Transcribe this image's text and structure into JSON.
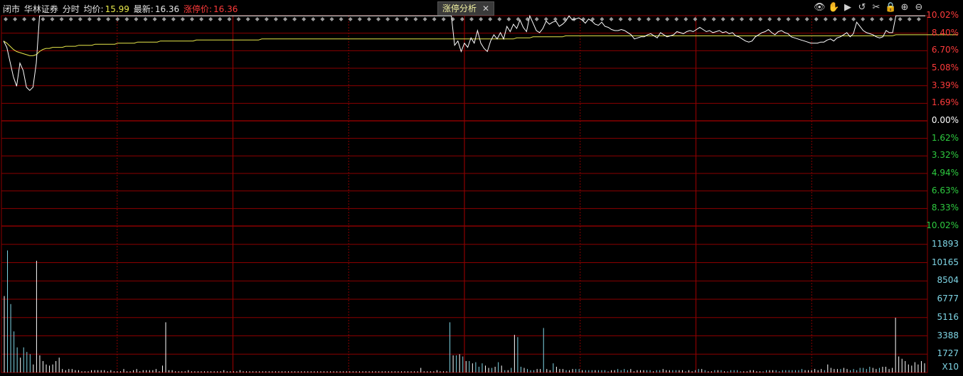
{
  "header": {
    "status": "闭市",
    "stock_name": "华林证券",
    "view_mode": "分时",
    "avg_label": "均价:",
    "avg_value": "15.99",
    "latest_label": "最新:",
    "latest_value": "16.36",
    "limit_label": "涨停价:",
    "limit_value": "16.36"
  },
  "analysis_tab": {
    "label": "涨停分析",
    "close": "✕"
  },
  "toolbar": {
    "items": [
      {
        "name": "eye-icon",
        "glyph": "👁"
      },
      {
        "name": "hand-icon",
        "glyph": "✋"
      },
      {
        "name": "play-icon",
        "glyph": "▶"
      },
      {
        "name": "undo-icon",
        "glyph": "↺"
      },
      {
        "name": "scissors-icon",
        "glyph": "✂"
      },
      {
        "name": "lock-icon",
        "glyph": "🔒"
      },
      {
        "name": "zoom-in-icon",
        "glyph": "⊕"
      },
      {
        "name": "zoom-out-icon",
        "glyph": "⊖"
      }
    ]
  },
  "colors": {
    "grid": "#8b0000",
    "price_line": "#ffffff",
    "avg_line": "#e8e84a",
    "up": "#ff3b3b",
    "down": "#2ecc40",
    "vol": "#7fd6e6",
    "vol_up": "#ffffff"
  },
  "chart_data": {
    "type": "line",
    "price_axis_labels": [
      {
        "text": "10.02%",
        "color": "up"
      },
      {
        "text": "8.40%",
        "color": "up"
      },
      {
        "text": "6.70%",
        "color": "up"
      },
      {
        "text": "5.08%",
        "color": "up"
      },
      {
        "text": "3.39%",
        "color": "up"
      },
      {
        "text": "1.69%",
        "color": "up"
      },
      {
        "text": "0.00%",
        "color": "white"
      },
      {
        "text": "1.62%",
        "color": "down"
      },
      {
        "text": "3.32%",
        "color": "down"
      },
      {
        "text": "4.94%",
        "color": "down"
      },
      {
        "text": "6.63%",
        "color": "down"
      },
      {
        "text": "8.33%",
        "color": "down"
      },
      {
        "text": "10.02%",
        "color": "down"
      }
    ],
    "volume_axis_labels": [
      "11893",
      "10165",
      "8504",
      "6777",
      "5116",
      "3388",
      "1727",
      "X10"
    ],
    "ylim_pct": [
      -10.02,
      10.02
    ],
    "price_pct": [
      7.6,
      7.0,
      5.6,
      4.2,
      3.3,
      5.5,
      4.8,
      3.2,
      2.9,
      3.2,
      5.5,
      10.0,
      10.0,
      10.0,
      10.0,
      10.0,
      10.0,
      10.0,
      10.0,
      10.0,
      10.0,
      10.0,
      10.0,
      10.0,
      10.0,
      10.0,
      10.0,
      10.0,
      10.0,
      10.0,
      10.0,
      10.0,
      10.0,
      10.0,
      10.0,
      10.0,
      10.0,
      10.0,
      10.0,
      10.0,
      10.0,
      10.0,
      10.0,
      10.0,
      10.0,
      10.0,
      10.0,
      10.0,
      10.0,
      10.0,
      10.0,
      10.0,
      10.0,
      10.0,
      10.0,
      10.0,
      10.0,
      10.0,
      10.0,
      10.0,
      10.0,
      10.0,
      10.0,
      10.0,
      10.0,
      10.0,
      10.0,
      10.0,
      10.0,
      10.0,
      10.0,
      10.0,
      10.0,
      10.0,
      10.0,
      10.0,
      10.0,
      10.0,
      10.0,
      10.0,
      10.0,
      10.0,
      10.0,
      10.0,
      10.0,
      10.0,
      10.0,
      10.0,
      10.0,
      10.0,
      10.0,
      10.0,
      10.0,
      10.0,
      10.0,
      10.0,
      10.0,
      10.0,
      10.0,
      10.0,
      10.0,
      10.0,
      10.0,
      10.0,
      10.0,
      10.0,
      10.0,
      10.0,
      10.0,
      10.0,
      10.0,
      10.0,
      10.0,
      10.0,
      10.0,
      10.0,
      10.0,
      10.0,
      10.0,
      10.0,
      10.0,
      10.0,
      10.0,
      10.0,
      10.0,
      10.0,
      10.0,
      10.0,
      10.0,
      10.0,
      10.0,
      10.0,
      10.0,
      10.0,
      10.0,
      10.0,
      10.0,
      10.0,
      7.2,
      7.6,
      6.6,
      7.4,
      7.0,
      7.9,
      7.4,
      8.6,
      7.4,
      6.9,
      6.6,
      7.6,
      8.2,
      7.8,
      8.4,
      7.8,
      9.0,
      8.5,
      9.2,
      8.8,
      9.6,
      8.9,
      8.5,
      10.0,
      9.3,
      8.6,
      8.4,
      8.8,
      9.5,
      9.2,
      9.4,
      9.5,
      9.0,
      9.2,
      9.5,
      10.0,
      9.6,
      9.7,
      9.8,
      9.6,
      9.3,
      9.7,
      9.5,
      9.2,
      9.1,
      9.4,
      9.0,
      8.9,
      8.7,
      8.6,
      8.6,
      8.7,
      8.6,
      8.4,
      8.2,
      7.8,
      7.9,
      8.0,
      8.0,
      8.2,
      8.3,
      8.1,
      7.9,
      8.4,
      8.2,
      8.0,
      8.1,
      8.2,
      8.5,
      8.4,
      8.3,
      8.5,
      8.6,
      8.5,
      8.7,
      8.9,
      8.7,
      8.5,
      8.6,
      8.4,
      8.5,
      8.6,
      8.4,
      8.5,
      8.3,
      8.4,
      8.1,
      8.0,
      7.8,
      7.6,
      7.5,
      7.6,
      8.0,
      8.2,
      8.4,
      8.5,
      8.7,
      8.4,
      8.2,
      8.5,
      8.6,
      8.4,
      8.3,
      8.0,
      7.9,
      7.8,
      7.7,
      7.6,
      7.5,
      7.4,
      7.4,
      7.4,
      7.5,
      7.5,
      7.7,
      7.8,
      7.6,
      7.9,
      8.0,
      8.2,
      8.4,
      8.0,
      8.3,
      9.4,
      9.0,
      8.6,
      8.4,
      8.3,
      8.2,
      8.0,
      7.9,
      8.0,
      8.6,
      8.4,
      8.4,
      10.0,
      10.0,
      10.0,
      10.0,
      10.0,
      10.0,
      10.0,
      10.0,
      10.0,
      10.0
    ],
    "avg_pct": [
      7.6,
      7.4,
      7.1,
      6.8,
      6.6,
      6.5,
      6.4,
      6.3,
      6.2,
      6.2,
      6.3,
      6.6,
      6.8,
      6.9,
      6.9,
      7.0,
      7.0,
      7.0,
      7.0,
      7.1,
      7.1,
      7.1,
      7.1,
      7.2,
      7.2,
      7.2,
      7.2,
      7.2,
      7.3,
      7.3,
      7.3,
      7.3,
      7.3,
      7.3,
      7.3,
      7.4,
      7.4,
      7.4,
      7.4,
      7.4,
      7.4,
      7.5,
      7.5,
      7.5,
      7.5,
      7.5,
      7.5,
      7.5,
      7.6,
      7.6,
      7.6,
      7.6,
      7.6,
      7.6,
      7.6,
      7.6,
      7.6,
      7.6,
      7.6,
      7.7,
      7.7,
      7.7,
      7.7,
      7.7,
      7.7,
      7.7,
      7.7,
      7.7,
      7.7,
      7.7,
      7.7,
      7.7,
      7.7,
      7.7,
      7.7,
      7.7,
      7.7,
      7.7,
      7.7,
      7.8,
      7.8,
      7.8,
      7.8,
      7.8,
      7.8,
      7.8,
      7.8,
      7.8,
      7.8,
      7.8,
      7.8,
      7.8,
      7.8,
      7.8,
      7.8,
      7.8,
      7.8,
      7.8,
      7.8,
      7.8,
      7.8,
      7.8,
      7.8,
      7.8,
      7.8,
      7.8,
      7.8,
      7.8,
      7.8,
      7.8,
      7.8,
      7.8,
      7.8,
      7.8,
      7.8,
      7.8,
      7.8,
      7.8,
      7.8,
      7.8,
      7.8,
      7.8,
      7.8,
      7.8,
      7.8,
      7.8,
      7.8,
      7.8,
      7.8,
      7.8,
      7.8,
      7.8,
      7.8,
      7.8,
      7.8,
      7.8,
      7.8,
      7.8,
      7.8,
      7.8,
      7.8,
      7.8,
      7.8,
      7.8,
      7.8,
      7.8,
      7.8,
      7.8,
      7.8,
      7.8,
      7.8,
      7.8,
      7.8,
      7.8,
      7.8,
      7.8,
      7.8,
      7.9,
      7.9,
      7.9,
      7.9,
      7.9,
      8.0,
      8.0,
      8.0,
      8.0,
      8.0,
      8.0,
      8.0,
      8.0,
      8.0,
      8.0,
      8.1,
      8.1,
      8.1,
      8.1,
      8.1,
      8.1,
      8.1,
      8.1,
      8.1,
      8.1,
      8.1,
      8.1,
      8.1,
      8.1,
      8.1,
      8.1,
      8.1,
      8.1,
      8.1,
      8.1,
      8.1,
      8.1,
      8.1,
      8.1,
      8.1,
      8.1,
      8.1,
      8.1,
      8.1,
      8.1,
      8.1,
      8.1,
      8.1,
      8.1,
      8.1,
      8.1,
      8.1,
      8.1,
      8.1,
      8.1,
      8.1,
      8.1,
      8.1,
      8.1,
      8.1,
      8.1,
      8.1,
      8.1,
      8.1,
      8.1,
      8.1,
      8.1,
      8.1,
      8.1,
      8.1,
      8.1,
      8.1,
      8.1,
      8.1,
      8.1,
      8.1,
      8.1,
      8.1,
      8.1,
      8.1,
      8.1,
      8.1,
      8.1,
      8.1,
      8.1,
      8.1,
      8.1,
      8.1,
      8.1,
      8.1,
      8.1,
      8.1,
      8.1,
      8.1,
      8.1,
      8.1,
      8.1,
      8.1,
      8.1,
      8.1,
      8.1,
      8.1,
      8.1,
      8.1,
      8.1,
      8.1,
      8.1,
      8.1,
      8.1,
      8.1,
      8.1,
      8.1,
      8.1,
      8.1,
      8.1,
      8.1,
      8.2,
      8.2,
      8.2,
      8.2,
      8.2,
      8.2,
      8.2,
      8.2,
      8.2,
      8.2,
      8.2,
      8.2,
      8.2,
      8.2,
      8.2,
      8.2,
      8.2,
      8.2,
      8.2,
      8.2
    ],
    "volume": [
      6700,
      10700,
      6000,
      3600,
      2200,
      1300,
      2200,
      1800,
      1600,
      700,
      9800,
      1500,
      1000,
      700,
      600,
      700,
      1000,
      1300,
      300,
      200,
      300,
      300,
      200,
      200,
      100,
      100,
      100,
      200,
      200,
      200,
      200,
      200,
      100,
      200,
      100,
      100,
      100,
      300,
      100,
      100,
      200,
      300,
      100,
      200,
      200,
      200,
      200,
      300,
      100,
      600,
      4400,
      200,
      200,
      100,
      100,
      100,
      100,
      200,
      100,
      100,
      100,
      100,
      100,
      100,
      100,
      100,
      100,
      100,
      200,
      100,
      100,
      100,
      100,
      200,
      100,
      100,
      100,
      100,
      100,
      100,
      100,
      100,
      100,
      100,
      100,
      100,
      100,
      100,
      100,
      100,
      100,
      100,
      100,
      100,
      100,
      100,
      100,
      100,
      100,
      100,
      100,
      100,
      100,
      100,
      100,
      100,
      100,
      100,
      100,
      100,
      100,
      100,
      100,
      100,
      100,
      100,
      100,
      100,
      100,
      100,
      100,
      100,
      100,
      100,
      100,
      100,
      100,
      100,
      100,
      400,
      100,
      100,
      100,
      100,
      200,
      100,
      100,
      100,
      4400,
      1500,
      1500,
      1600,
      1400,
      1000,
      1000,
      800,
      900,
      500,
      800,
      600,
      400,
      400,
      500,
      900,
      600,
      200,
      200,
      400,
      3300,
      3100,
      500,
      400,
      300,
      200,
      200,
      300,
      300,
      3900,
      300,
      200,
      800,
      500,
      300,
      300,
      200,
      200,
      300,
      300,
      300,
      200,
      200,
      200,
      200,
      200,
      200,
      200,
      200,
      100,
      200,
      200,
      300,
      200,
      300,
      200,
      300,
      100,
      200,
      200,
      200,
      200,
      200,
      100,
      200,
      200,
      300,
      200,
      200,
      200,
      200,
      200,
      200,
      100,
      200,
      100,
      200,
      300,
      300,
      200,
      100,
      100,
      200,
      200,
      200,
      100,
      100,
      200,
      200,
      200,
      100,
      100,
      100,
      200,
      200,
      100,
      100,
      100,
      200,
      200,
      200,
      200,
      100,
      200,
      200,
      200,
      200,
      200,
      200,
      300,
      200,
      200,
      200,
      300,
      200,
      300,
      200,
      700,
      400,
      300,
      300,
      300,
      400,
      300,
      200,
      300,
      200,
      400,
      400,
      300,
      500,
      400,
      300,
      400,
      500,
      500,
      300,
      400,
      4800,
      1400,
      1200,
      1000,
      700,
      600,
      900,
      700,
      1000,
      800
    ]
  }
}
